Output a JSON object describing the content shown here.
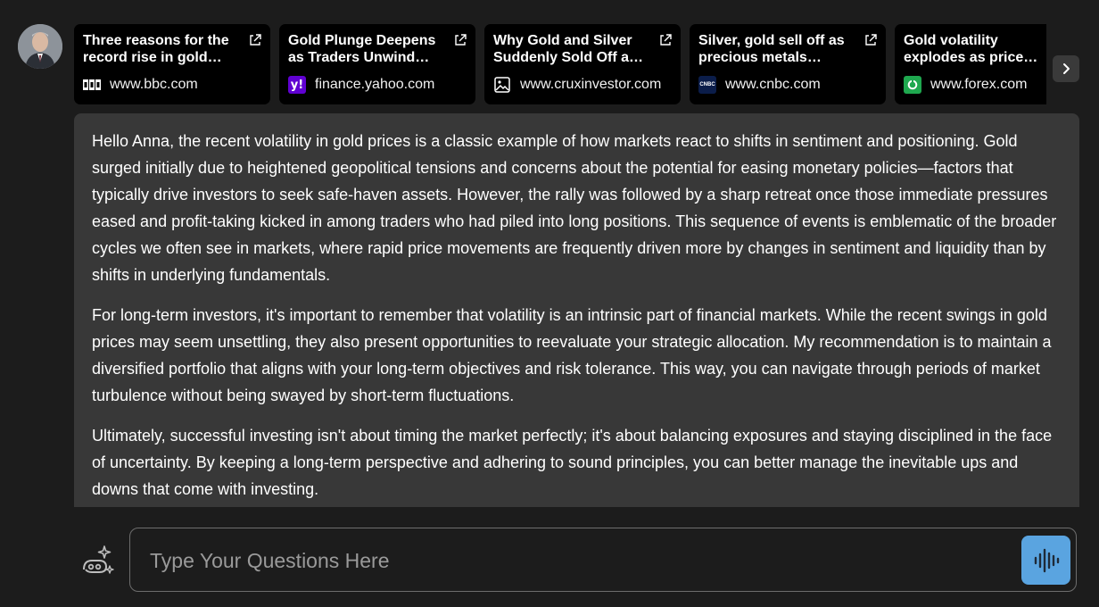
{
  "sources": [
    {
      "title": "Three reasons for the record rise in gold…",
      "domain": "www.bbc.com",
      "icon": "bbc-logo-icon"
    },
    {
      "title": "Gold Plunge Deepens as Traders Unwind…",
      "domain": "finance.yahoo.com",
      "icon": "yahoo-logo-icon"
    },
    {
      "title": "Why Gold and Silver Suddenly Sold Off a…",
      "domain": "www.cruxinvestor.com",
      "icon": "image-placeholder-icon"
    },
    {
      "title": "Silver, gold sell off as precious metals…",
      "domain": "www.cnbc.com",
      "icon": "cnbc-logo-icon",
      "icon_text": "CNBC"
    },
    {
      "title": "Gold volatility explodes as price…",
      "domain": "www.forex.com",
      "icon": "forex-logo-icon"
    }
  ],
  "message": {
    "paragraphs": [
      "Hello Anna, the recent volatility in gold prices is a classic example of how markets react to shifts in sentiment and positioning. Gold surged initially due to heightened geopolitical tensions and concerns about the potential for easing monetary policies—factors that typically drive investors to seek safe-haven assets. However, the rally was followed by a sharp retreat once those immediate pressures eased and profit-taking kicked in among traders who had piled into long positions. This sequence of events is emblematic of the broader cycles we often see in markets, where rapid price movements are frequently driven more by changes in sentiment and liquidity than by shifts in underlying fundamentals.",
      "For long-term investors, it's important to remember that volatility is an intrinsic part of financial markets. While the recent swings in gold prices may seem unsettling, they also present opportunities to reevaluate your strategic allocation. My recommendation is to maintain a diversified portfolio that aligns with your long-term objectives and risk tolerance. This way, you can navigate through periods of market turbulence without being swayed by short-term fluctuations.",
      "Ultimately, successful investing isn't about timing the market perfectly; it's about balancing exposures and staying disciplined in the face of uncertainty. By keeping a long-term perspective and adhering to sound principles, you can better manage the inevitable ups and downs that come with investing."
    ]
  },
  "input": {
    "placeholder": "Type Your Questions Here",
    "value": ""
  },
  "colors": {
    "background": "#1c1c1c",
    "message_bg": "#383838",
    "card_bg": "#000000",
    "mic_button": "#5aa4e0"
  }
}
